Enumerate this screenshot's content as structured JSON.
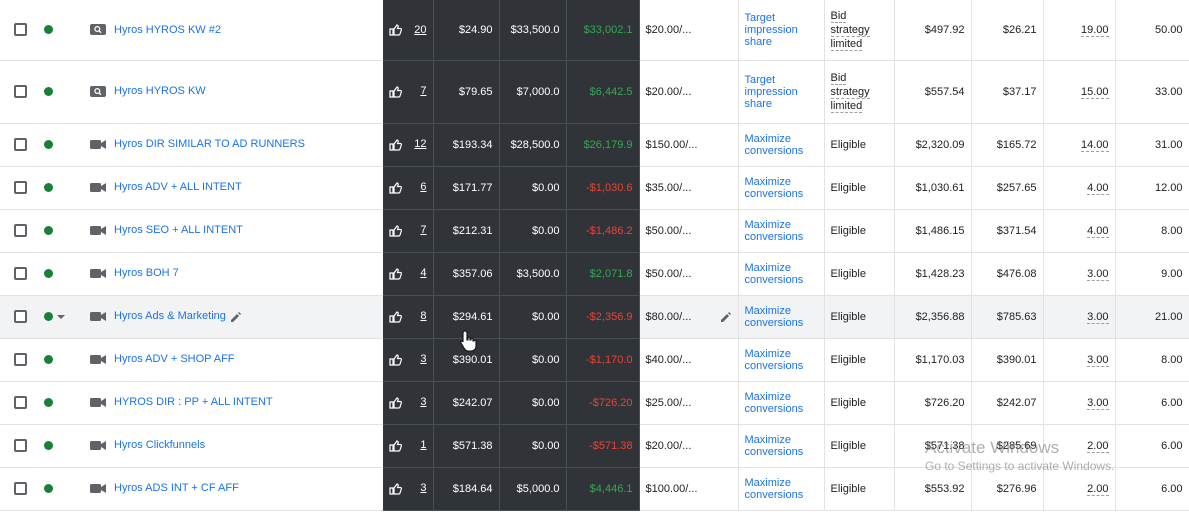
{
  "colors": {
    "link": "#1a73e8",
    "dark_cells": "#303439",
    "positive": "#34a853",
    "negative": "#ea4335",
    "status_dot": "#188038"
  },
  "rows": [
    {
      "name": "Hyros HYROS KW #2",
      "type_icon": "search-icon",
      "impressions": "20",
      "c1": "$24.90",
      "c2": "$33,500.0",
      "c3": "$33,002.1",
      "c3_sign": "pos",
      "budget": "$20.00/...",
      "strategy": [
        "Target",
        "impression",
        "share"
      ],
      "status": [
        "Bid",
        "strategy",
        "limited"
      ],
      "cost": "$497.92",
      "cpc": "$26.21",
      "conv": "19.00",
      "all_conv": "50.00"
    },
    {
      "name": "Hyros HYROS KW",
      "type_icon": "search-icon",
      "impressions": "7",
      "c1": "$79.65",
      "c2": "$7,000.0",
      "c3": "$6,442.5",
      "c3_sign": "pos",
      "budget": "$20.00/...",
      "strategy": [
        "Target",
        "impression",
        "share"
      ],
      "status": [
        "Bid",
        "strategy",
        "limited"
      ],
      "cost": "$557.54",
      "cpc": "$37.17",
      "conv": "15.00",
      "all_conv": "33.00"
    },
    {
      "name": "Hyros DIR SIMILAR TO AD RUNNERS",
      "type_icon": "video-icon",
      "impressions": "12",
      "c1": "$193.34",
      "c2": "$28,500.0",
      "c3": "$26,179.9",
      "c3_sign": "pos",
      "budget": "$150.00/...",
      "strategy": [
        "Maximize",
        "conversions"
      ],
      "status": [
        "Eligible"
      ],
      "cost": "$2,320.09",
      "cpc": "$165.72",
      "conv": "14.00",
      "all_conv": "31.00"
    },
    {
      "name": "Hyros ADV + ALL INTENT",
      "type_icon": "video-icon",
      "impressions": "6",
      "c1": "$171.77",
      "c2": "$0.00",
      "c3": "-$1,030.6",
      "c3_sign": "neg",
      "budget": "$35.00/...",
      "strategy": [
        "Maximize",
        "conversions"
      ],
      "status": [
        "Eligible"
      ],
      "cost": "$1,030.61",
      "cpc": "$257.65",
      "conv": "4.00",
      "all_conv": "12.00"
    },
    {
      "name": "Hyros SEO + ALL INTENT",
      "type_icon": "video-icon",
      "impressions": "7",
      "c1": "$212.31",
      "c2": "$0.00",
      "c3": "-$1,486.2",
      "c3_sign": "neg",
      "budget": "$50.00/...",
      "strategy": [
        "Maximize",
        "conversions"
      ],
      "status": [
        "Eligible"
      ],
      "cost": "$1,486.15",
      "cpc": "$371.54",
      "conv": "4.00",
      "all_conv": "8.00"
    },
    {
      "name": "Hyros BOH 7",
      "type_icon": "video-icon",
      "impressions": "4",
      "c1": "$357.06",
      "c2": "$3,500.0",
      "c3": "$2,071.8",
      "c3_sign": "pos",
      "budget": "$50.00/...",
      "strategy": [
        "Maximize",
        "conversions"
      ],
      "status": [
        "Eligible"
      ],
      "cost": "$1,428.23",
      "cpc": "$476.08",
      "conv": "3.00",
      "all_conv": "9.00"
    },
    {
      "name": "Hyros Ads & Marketing",
      "type_icon": "video-icon",
      "impressions": "8",
      "c1": "$294.61",
      "c2": "$0.00",
      "c3": "-$2,356.9",
      "c3_sign": "neg",
      "budget": "$80.00/...",
      "strategy": [
        "Maximize",
        "conversions"
      ],
      "status": [
        "Eligible"
      ],
      "cost": "$2,356.88",
      "cpc": "$785.63",
      "conv": "3.00",
      "all_conv": "21.00",
      "highlight": true
    },
    {
      "name": "Hyros ADV + SHOP AFF",
      "type_icon": "video-icon",
      "impressions": "3",
      "c1": "$390.01",
      "c2": "$0.00",
      "c3": "-$1,170.0",
      "c3_sign": "neg",
      "budget": "$40.00/...",
      "strategy": [
        "Maximize",
        "conversions"
      ],
      "status": [
        "Eligible"
      ],
      "cost": "$1,170.03",
      "cpc": "$390.01",
      "conv": "3.00",
      "all_conv": "8.00"
    },
    {
      "name": "HYROS DIR : PP + ALL INTENT",
      "type_icon": "video-icon",
      "impressions": "3",
      "c1": "$242.07",
      "c2": "$0.00",
      "c3": "-$726.20",
      "c3_sign": "neg",
      "budget": "$25.00/...",
      "strategy": [
        "Maximize",
        "conversions"
      ],
      "status": [
        "Eligible"
      ],
      "cost": "$726.20",
      "cpc": "$242.07",
      "conv": "3.00",
      "all_conv": "6.00"
    },
    {
      "name": "Hyros Clickfunnels",
      "type_icon": "video-icon",
      "impressions": "1",
      "c1": "$571.38",
      "c2": "$0.00",
      "c3": "-$571.38",
      "c3_sign": "neg",
      "budget": "$20.00/...",
      "strategy": [
        "Maximize",
        "conversions"
      ],
      "status": [
        "Eligible"
      ],
      "cost": "$571.38",
      "cpc": "$285.69",
      "conv": "2.00",
      "all_conv": "6.00"
    },
    {
      "name": "Hyros ADS INT + CF AFF",
      "type_icon": "video-icon",
      "impressions": "3",
      "c1": "$184.64",
      "c2": "$5,000.0",
      "c3": "$4,446.1",
      "c3_sign": "pos",
      "budget": "$100.00/...",
      "strategy": [
        "Maximize",
        "conversions"
      ],
      "status": [
        "Eligible"
      ],
      "cost": "$553.92",
      "cpc": "$276.96",
      "conv": "2.00",
      "all_conv": "6.00"
    }
  ],
  "watermark": {
    "line1": "Activate Windows",
    "line2": "Go to Settings to activate Windows."
  }
}
